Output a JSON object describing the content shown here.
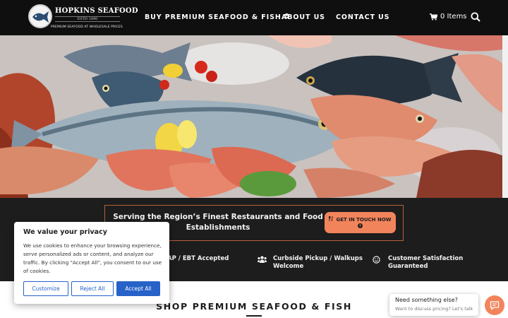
{
  "brand": {
    "name": "HOPKINS SEAFOOD",
    "established": "ESTD 1890",
    "tagline": "PREMIUM SEAFOOD AT WHOLESALE PRICES"
  },
  "nav": {
    "items": [
      {
        "label": "BUY PREMIUM SEAFOOD & FISH"
      },
      {
        "label": "ABOUT US"
      },
      {
        "label": "CONTACT US"
      }
    ],
    "cart_label": "0 Items"
  },
  "promo": {
    "text": "Serving the Region’s Finest Restaurants and Food Establishments",
    "cta_label": "GET IN TOUCH NOW"
  },
  "features": [
    {
      "label": "SNAP / EBT Accepted",
      "visible_label": "AP / EBT Accepted",
      "icon": "card-icon"
    },
    {
      "label": "Curbside Pickup / Walkups Welcome",
      "line1": "Curbside Pickup / Walkups",
      "line2": "Welcome",
      "icon": "users-icon"
    },
    {
      "label": "Customer Satisfaction Guaranteed",
      "line1": "Customer Satisfaction",
      "line2": "Guaranteed",
      "icon": "smile-icon"
    }
  ],
  "shop": {
    "title": "SHOP PREMIUM SEAFOOD & FISH"
  },
  "cookie": {
    "title": "We value your privacy",
    "body": "We use cookies to enhance your browsing experience, serve personalized ads or content, and analyze our traffic. By clicking \"Accept All\", you consent to our use of cookies.",
    "customize": "Customize",
    "reject": "Reject All",
    "accept": "Accept All"
  },
  "chat": {
    "line1": "Need something else?",
    "line2": "Want to discuss pricing? Let's talk"
  },
  "colors": {
    "header_bg": "#0f0f0f",
    "band_bg": "#1d1d1d",
    "accent": "#f2845c",
    "cookie_button": "#2762c8"
  }
}
